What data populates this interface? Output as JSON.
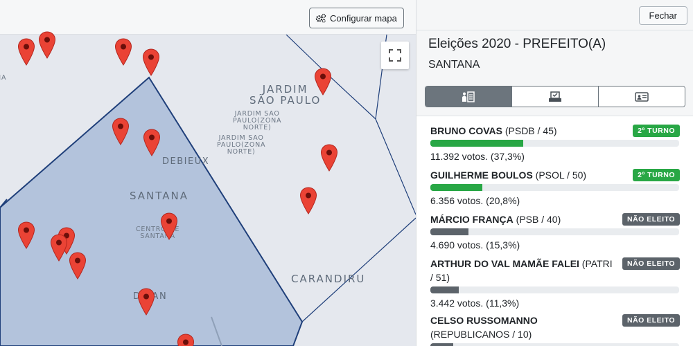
{
  "map": {
    "config_label": "Configurar mapa",
    "labels": {
      "jardim_sao_paulo": "JARDIM\nSÃO PAULO",
      "jardim_sao_paulo_zn_1": "JARDIM SAO\nPAULO(ZONA\nNORTE)",
      "jardim_sao_paulo_zn_2": "JARDIM SAO\nPAULO(ZONA\nNORTE)",
      "debieux": "DEBIEUX",
      "santana": "SANTANA",
      "centro_santana": "CENTRO DE\nSANTANA",
      "carandiru": "CARANDIRU",
      "dozan": "D   ZAN",
      "left_edge": "\nHA"
    },
    "icons": {
      "config": "gear-icon",
      "fullscreen": "fullscreen-icon",
      "pin": "map-pin-icon"
    }
  },
  "panel": {
    "close_label": "Fechar",
    "title": "Eleições 2020 - PREFEITO(A)",
    "subtitle": "SANTANA",
    "tabs": [
      {
        "icon": "candidates-icon",
        "active": true
      },
      {
        "icon": "ballot-box-icon",
        "active": false
      },
      {
        "icon": "id-card-icon",
        "active": false
      }
    ],
    "candidates": [
      {
        "name": "BRUNO COVAS",
        "party": " (PSDB / 45)",
        "badge": "2º TURNO",
        "status": "green",
        "votes": "11.392 votos. (37,3%)",
        "pct": 37.3
      },
      {
        "name": "GUILHERME BOULOS",
        "party": " (PSOL / 50)",
        "badge": "2º TURNO",
        "status": "green",
        "votes": "6.356 votos. (20,8%)",
        "pct": 20.8
      },
      {
        "name": "MÁRCIO FRANÇA",
        "party": " (PSB / 40)",
        "badge": "NÃO ELEITO",
        "status": "gray",
        "votes": "4.690 votos. (15,3%)",
        "pct": 15.3
      },
      {
        "name": "ARTHUR DO VAL MAMÃE FALEI",
        "party": " (PATRI / 51)",
        "badge": "NÃO ELEITO",
        "status": "gray",
        "votes": "3.442 votos. (11,3%)",
        "pct": 11.3
      },
      {
        "name": "CELSO RUSSOMANNO",
        "party": " (REPUBLICANOS / 10)",
        "badge": "NÃO ELEITO",
        "status": "gray",
        "votes": "",
        "pct": 9.3
      }
    ]
  },
  "colors": {
    "green": "#28a745",
    "gray": "#5c636a",
    "pin_red": "#ea4335",
    "region_fill": "#b3c3dc",
    "boundary": "#1f3f7a"
  }
}
